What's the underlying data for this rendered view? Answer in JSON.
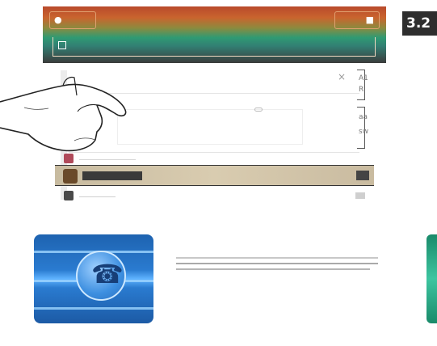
{
  "step_badge": "3.2",
  "topbar": {
    "left_icon": "person-icon",
    "right_icon": "folder-icon",
    "field_icon": "square-icon"
  },
  "panel": {
    "close_label": "×",
    "right_tags": [
      "A1",
      "R",
      "aa",
      "sw"
    ],
    "rows": [
      {
        "icon": "doc-icon"
      },
      {
        "icon": "doc-icon"
      },
      {
        "icon": "doc-icon"
      }
    ]
  },
  "tiles": {
    "left_icon": "phone-icon",
    "phone_glyph": "☎",
    "right_accent": "#2bb592"
  },
  "colors": {
    "topbar_top": "#b94a2c",
    "topbar_mid": "#2f9a73",
    "selected_row": "#d4c6aa",
    "tile_blue": "#2a7bd0"
  }
}
